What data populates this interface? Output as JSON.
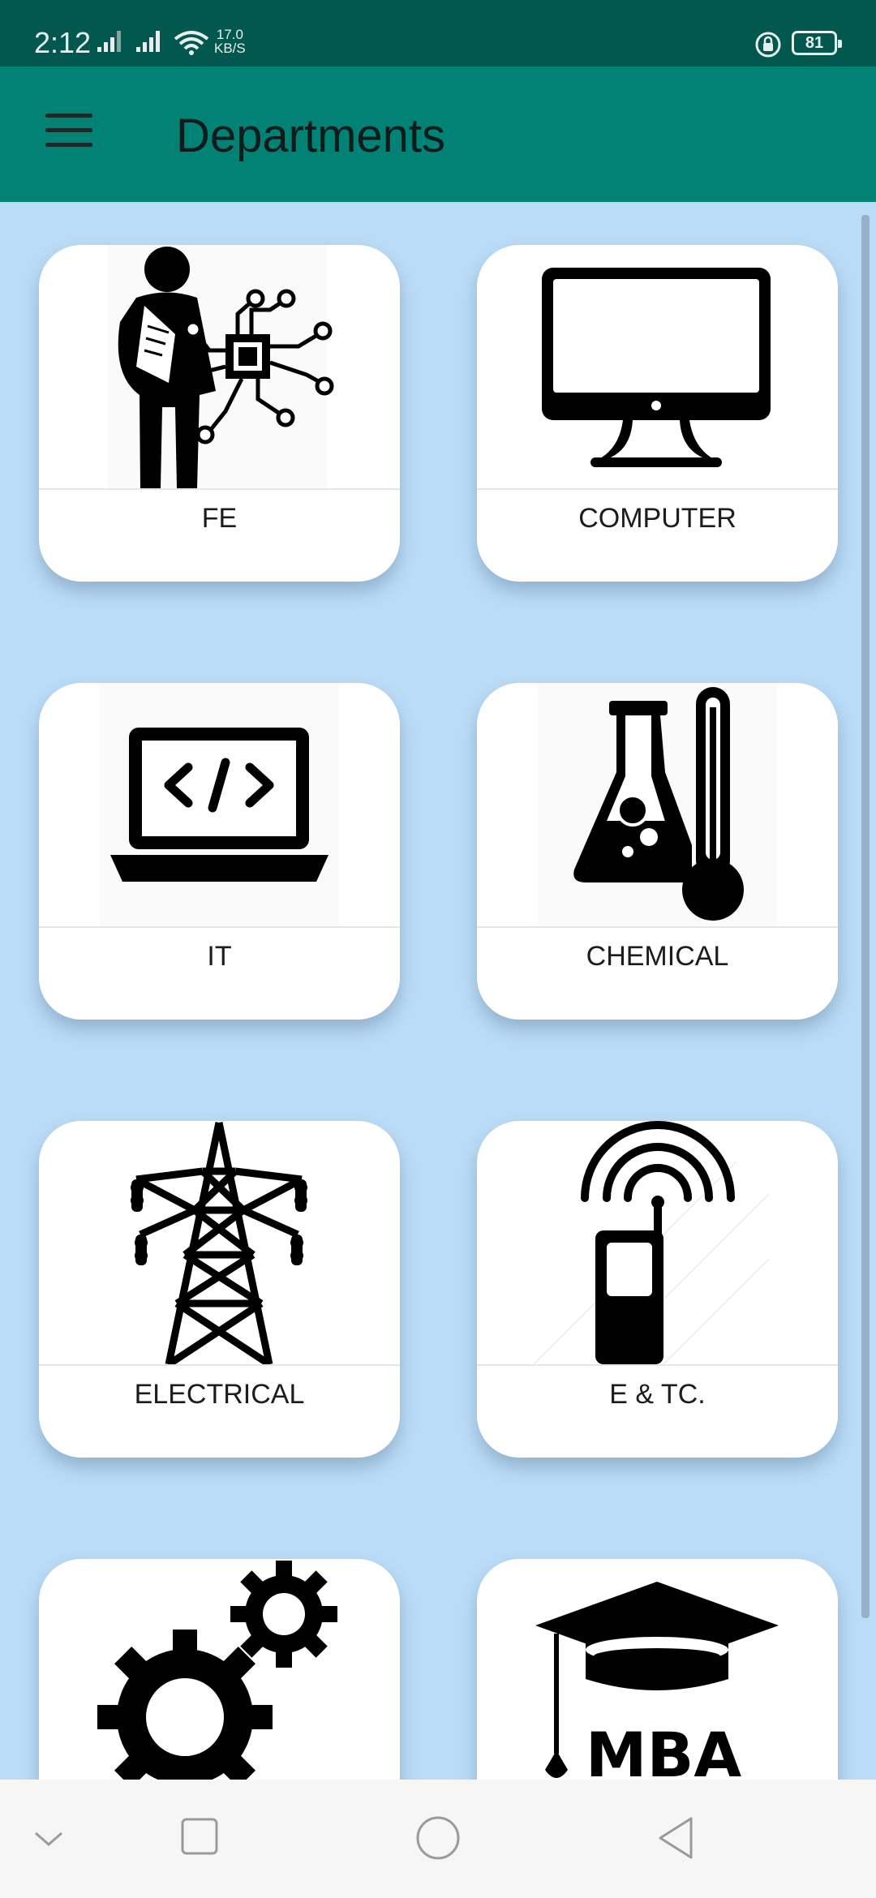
{
  "status_bar": {
    "time": "2:12",
    "net_speed_value": "17.0",
    "net_speed_unit": "KB/S",
    "battery": "81",
    "signal_icon": "signal-bars-icon",
    "wifi_icon": "wifi-icon",
    "lock_icon": "rotation-lock-icon"
  },
  "app_bar": {
    "title": "Departments",
    "menu_icon": "hamburger-menu-icon",
    "background": "#018274"
  },
  "departments": [
    {
      "label": "FE",
      "icon": "student-circuit-icon"
    },
    {
      "label": "COMPUTER",
      "icon": "desktop-monitor-icon"
    },
    {
      "label": "IT",
      "icon": "laptop-code-icon"
    },
    {
      "label": "CHEMICAL",
      "icon": "flask-thermometer-icon"
    },
    {
      "label": "ELECTRICAL",
      "icon": "transmission-tower-icon"
    },
    {
      "label": "E & TC.",
      "icon": "mobile-signal-icon"
    },
    {
      "label": "",
      "icon": "gears-icon"
    },
    {
      "label": "",
      "icon": "mba-graduation-cap-icon",
      "text": "MBA"
    }
  ],
  "nav_bar": {
    "items": [
      "hide-nav-icon",
      "recents-icon",
      "home-icon",
      "back-icon"
    ]
  },
  "colors": {
    "status_bar": "#02574e",
    "page_background": "#bbdcf6",
    "card": "#ffffff"
  }
}
